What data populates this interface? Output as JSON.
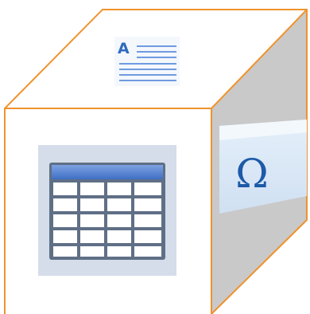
{
  "illustration": {
    "top_face": {
      "icon": "text-document-icon",
      "letter": "A"
    },
    "front_face": {
      "icon": "table-icon"
    },
    "side_face": {
      "icon": "symbol-omega-icon",
      "glyph": "Ω"
    },
    "colors": {
      "edge": "#f0922c",
      "side_face": "#c9c9c9",
      "accent_blue": "#2f6bbd",
      "table_header": "#5b86d3"
    }
  }
}
